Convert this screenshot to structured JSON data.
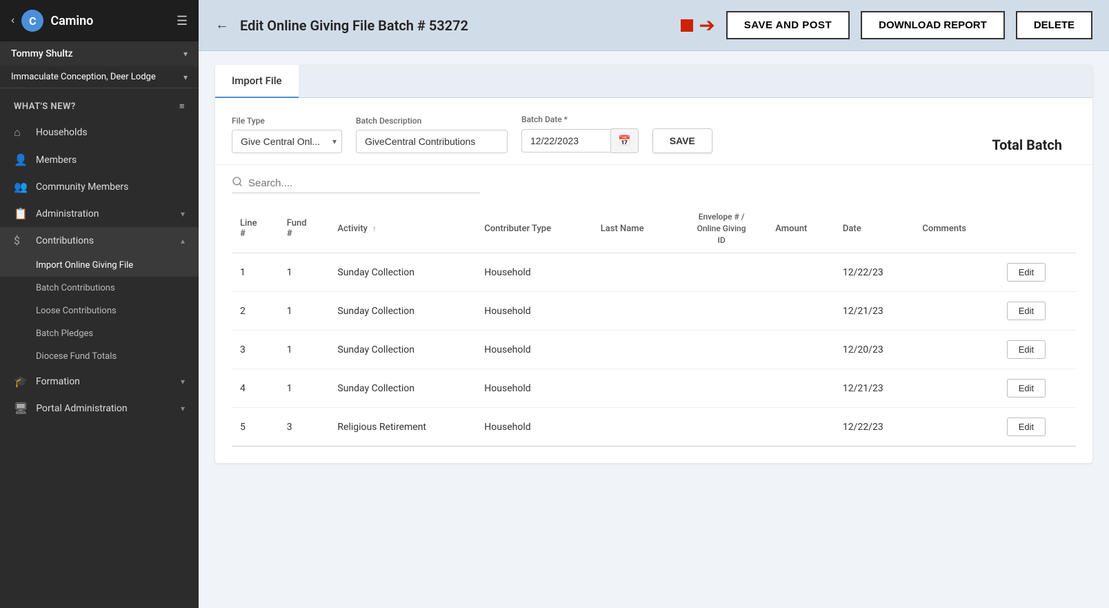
{
  "sidebar": {
    "back_label": "‹",
    "logo_text": "C",
    "app_name": "Camino",
    "user_name": "Tommy Shultz",
    "org_name": "Immaculate Conception, Deer Lodge",
    "whats_new": "WHAT'S NEW?",
    "nav_items": [
      {
        "id": "households",
        "label": "Households",
        "icon": "🏠",
        "has_children": false
      },
      {
        "id": "members",
        "label": "Members",
        "icon": "👤",
        "has_children": false
      },
      {
        "id": "community-members",
        "label": "Community Members",
        "icon": "👥",
        "has_children": false
      },
      {
        "id": "administration",
        "label": "Administration",
        "icon": "📋",
        "has_children": true,
        "expanded": false
      },
      {
        "id": "contributions",
        "label": "Contributions",
        "icon": "💲",
        "has_children": true,
        "expanded": true
      },
      {
        "id": "formation",
        "label": "Formation",
        "icon": "🎓",
        "has_children": true,
        "expanded": false
      },
      {
        "id": "portal-administration",
        "label": "Portal Administration",
        "icon": "🖥",
        "has_children": true,
        "expanded": false
      }
    ],
    "contributions_sub": [
      {
        "id": "import-online-giving",
        "label": "Import Online Giving File",
        "active": true
      },
      {
        "id": "batch-contributions",
        "label": "Batch Contributions"
      },
      {
        "id": "loose-contributions",
        "label": "Loose Contributions"
      },
      {
        "id": "batch-pledges",
        "label": "Batch Pledges"
      },
      {
        "id": "diocese-fund-totals",
        "label": "Diocese Fund Totals"
      }
    ]
  },
  "header": {
    "back_label": "←",
    "title": "Edit Online Giving File Batch # 53272",
    "save_post_label": "SAVE AND POST",
    "download_report_label": "DOWNLOAD REPORT",
    "delete_label": "DELETE"
  },
  "tabs": [
    {
      "id": "import-file",
      "label": "Import File",
      "active": true
    }
  ],
  "form": {
    "file_type_label": "File Type",
    "file_type_value": "Give Central Onl...",
    "batch_description_label": "Batch Description",
    "batch_description_value": "GiveCentral Contributions",
    "batch_date_label": "Batch Date *",
    "batch_date_value": "12/22/2023",
    "save_label": "SAVE",
    "total_batch_label": "Total Batch"
  },
  "search": {
    "placeholder": "Search...."
  },
  "table": {
    "columns": [
      {
        "id": "line",
        "label": "Line #"
      },
      {
        "id": "fund",
        "label": "Fund #"
      },
      {
        "id": "activity",
        "label": "Activity",
        "sortable": true
      },
      {
        "id": "contributor_type",
        "label": "Contributer Type"
      },
      {
        "id": "last_name",
        "label": "Last Name"
      },
      {
        "id": "envelope",
        "label": "Envelope # / Online Giving ID",
        "multiline": true
      },
      {
        "id": "amount",
        "label": "Amount"
      },
      {
        "id": "date",
        "label": "Date"
      },
      {
        "id": "comments",
        "label": "Comments"
      },
      {
        "id": "action",
        "label": ""
      }
    ],
    "rows": [
      {
        "line": 1,
        "fund": 1,
        "activity": "Sunday Collection",
        "contributor_type": "Household",
        "last_name": "",
        "envelope": "",
        "amount": "",
        "date": "12/22/23",
        "comments": "",
        "edit_label": "Edit"
      },
      {
        "line": 2,
        "fund": 1,
        "activity": "Sunday Collection",
        "contributor_type": "Household",
        "last_name": "",
        "envelope": "",
        "amount": "",
        "date": "12/21/23",
        "comments": "",
        "edit_label": "Edit"
      },
      {
        "line": 3,
        "fund": 1,
        "activity": "Sunday Collection",
        "contributor_type": "Household",
        "last_name": "",
        "envelope": "",
        "amount": "",
        "date": "12/20/23",
        "comments": "",
        "edit_label": "Edit"
      },
      {
        "line": 4,
        "fund": 1,
        "activity": "Sunday Collection",
        "contributor_type": "Household",
        "last_name": "",
        "envelope": "",
        "amount": "",
        "date": "12/21/23",
        "comments": "",
        "edit_label": "Edit"
      },
      {
        "line": 5,
        "fund": 3,
        "activity": "Religious Retirement",
        "contributor_type": "Household",
        "last_name": "",
        "envelope": "",
        "amount": "",
        "date": "12/22/23",
        "comments": "",
        "edit_label": "Edit"
      }
    ]
  }
}
